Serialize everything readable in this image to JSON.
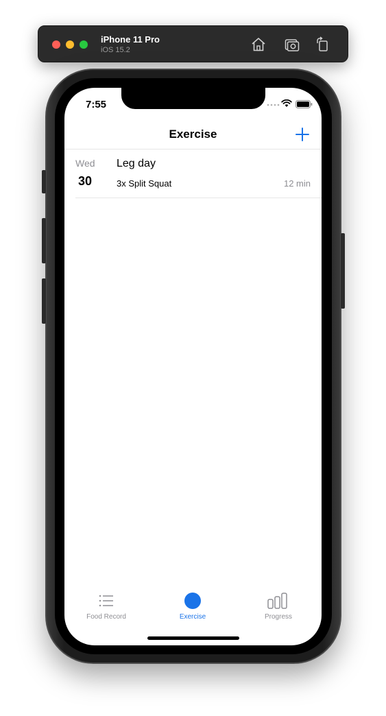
{
  "simulator": {
    "device_name": "iPhone 11 Pro",
    "os_version": "iOS 15.2",
    "icons": [
      "home-icon",
      "screenshot-icon",
      "rotate-icon"
    ]
  },
  "status_bar": {
    "time": "7:55"
  },
  "nav": {
    "title": "Exercise",
    "add_icon": "plus-icon"
  },
  "exercises": [
    {
      "weekday": "Wed",
      "day": "30",
      "title": "Leg day",
      "detail": "3x Split Squat",
      "duration": "12 min"
    }
  ],
  "tabs": [
    {
      "label": "Food Record",
      "icon": "list-icon",
      "active": false
    },
    {
      "label": "Exercise",
      "icon": "circle-icon",
      "active": true
    },
    {
      "label": "Progress",
      "icon": "bar-chart-icon",
      "active": false
    }
  ],
  "colors": {
    "accent": "#1a73e8",
    "inactive": "#8e8e93"
  }
}
